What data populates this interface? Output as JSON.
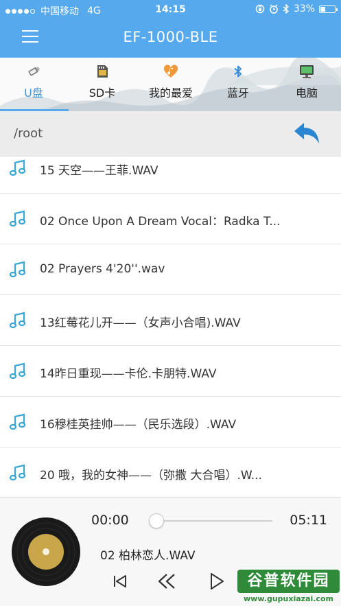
{
  "status_bar": {
    "carrier": "中国移动",
    "network": "4G",
    "time": "14:15",
    "battery_percent": "33%",
    "battery_level": 0.33,
    "signal_bars": 4,
    "signal_total": 5
  },
  "navbar": {
    "title": "EF-1000-BLE"
  },
  "tabs": [
    {
      "label": "U盘",
      "icon": "usb-drive-icon",
      "active": true
    },
    {
      "label": "SD卡",
      "icon": "sd-card-icon",
      "active": false
    },
    {
      "label": "我的最爱",
      "icon": "favorite-heart-icon",
      "active": false
    },
    {
      "label": "蓝牙",
      "icon": "bluetooth-icon",
      "active": false
    },
    {
      "label": "电脑",
      "icon": "computer-icon",
      "active": false
    }
  ],
  "path_bar": {
    "path": "/root"
  },
  "files": [
    {
      "name": "15 天空——王菲.WAV"
    },
    {
      "name": "02 Once Upon A Dream Vocal：Radka T..."
    },
    {
      "name": "02 Prayers 4'20''.wav"
    },
    {
      "name": "13红莓花儿开——（女声小合唱).WAV"
    },
    {
      "name": "14昨日重现——卡伦.卡朋特.WAV"
    },
    {
      "name": "16穆桂英挂帅——（民乐选段）.WAV"
    },
    {
      "name": "20  哦，我的女神——（弥撒 大合唱）.W..."
    }
  ],
  "player": {
    "current_time": "00:00",
    "total_time": "05:11",
    "progress": 0,
    "song_title": "02 柏林恋人.WAV"
  },
  "watermark": {
    "brand": "谷普软件园",
    "url": "www.gupuxiazai.com"
  },
  "colors": {
    "header_blue": "#56a9ec",
    "icon_blue": "#3ea6d8",
    "record_gold": "#c9a64a"
  }
}
